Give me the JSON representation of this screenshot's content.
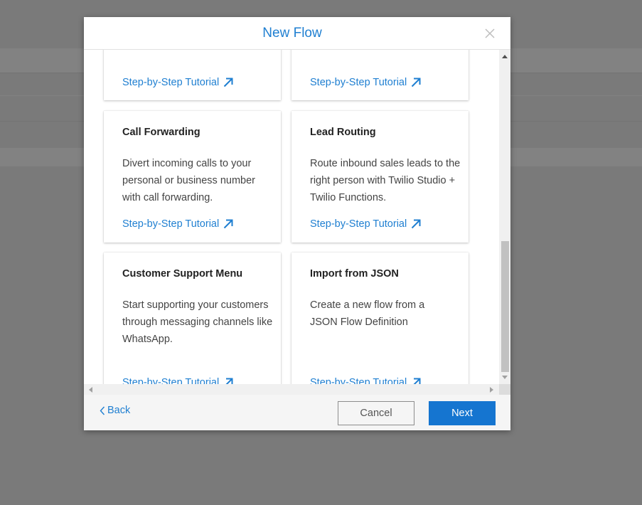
{
  "modal": {
    "title": "New Flow"
  },
  "cards": [
    {
      "title": "",
      "description": "",
      "link": "Step-by-Step Tutorial"
    },
    {
      "title": "",
      "description": "",
      "link": "Step-by-Step Tutorial"
    },
    {
      "title": "Call Forwarding",
      "description": "Divert incoming calls to your personal or business number with call forwarding.",
      "link": "Step-by-Step Tutorial"
    },
    {
      "title": "Lead Routing",
      "description": "Route inbound sales leads to the right person with Twilio Studio + Twilio Functions.",
      "link": "Step-by-Step Tutorial"
    },
    {
      "title": "Customer Support Menu",
      "description": "Start supporting your customers through messaging channels like WhatsApp.",
      "link": "Step-by-Step Tutorial"
    },
    {
      "title": "Import from JSON",
      "description": "Create a new flow from a JSON Flow Definition",
      "link": "Step-by-Step Tutorial"
    }
  ],
  "footer": {
    "back_label": "Back",
    "cancel_label": "Cancel",
    "next_label": "Next"
  },
  "colors": {
    "accent": "#1f7fd1",
    "primary_button": "#1575d0",
    "overlay": "#7a7a7a"
  },
  "icons": {
    "close": "close-icon",
    "external": "arrow-up-right-icon",
    "back": "chevron-left-icon"
  },
  "scroll": {
    "vertical_position": 0.75
  }
}
